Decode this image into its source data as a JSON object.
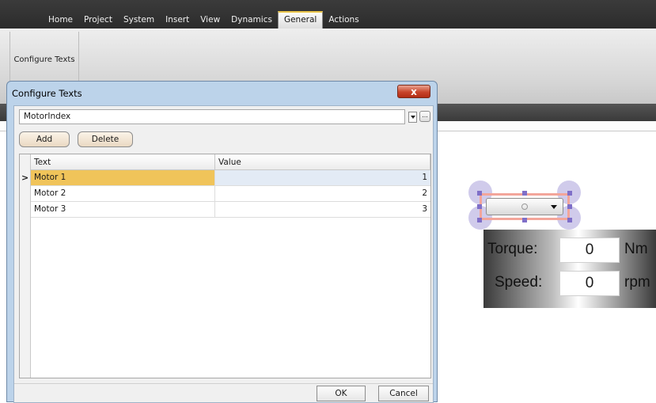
{
  "ribbon": {
    "tabs": [
      "Home",
      "Project",
      "System",
      "Insert",
      "View",
      "Dynamics",
      "General",
      "Actions"
    ],
    "active_tab": "General",
    "configure_texts_button": "Configure Texts"
  },
  "dialog": {
    "title": "Configure Texts",
    "close_label": "x",
    "text_list_selection": "MotorIndex",
    "ellipsis_label": "...",
    "add_label": "Add",
    "delete_label": "Delete",
    "grid": {
      "columns": [
        "Text",
        "Value"
      ],
      "rows": [
        {
          "text": "Motor 1",
          "value": "1"
        },
        {
          "text": "Motor 2",
          "value": "2"
        },
        {
          "text": "Motor 3",
          "value": "3"
        }
      ],
      "selected_row": 0,
      "row_indicator": ">"
    },
    "ok_label": "OK",
    "cancel_label": "Cancel"
  },
  "canvas": {
    "torque_label": "Torque:",
    "torque_value": "0",
    "torque_unit": "Nm",
    "speed_label": "Speed:",
    "speed_value": "0",
    "speed_unit": "rpm"
  }
}
